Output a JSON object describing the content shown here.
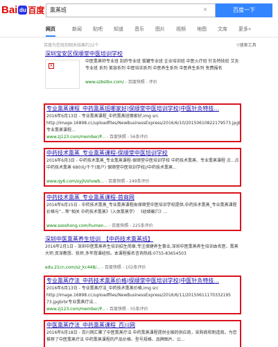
{
  "brand": {
    "bai": "Bai",
    "paw": "du",
    "du": "百度"
  },
  "search": {
    "query": "熏蒸班",
    "clear": "×",
    "button": "百度一下"
  },
  "tabs": [
    "网页",
    "新闻",
    "贴吧",
    "知道",
    "音乐",
    "图片",
    "视频",
    "地图",
    "文库",
    "更多»"
  ],
  "result_count": "百度为您找到相关结果约32个",
  "tools_label": "▽搜索工具",
  "results": [
    {
      "title": "深圳宝安区保顺堂中医培训学校",
      "abstract": "中医熏蒸师专业班 刮痧专业班 拔罐专业班 企业培训班 中医火疗班 针灸特技班 艾灸专业班 系列 美容系列 中医培训系列 中医养生系列 中医养生系列 免费报名",
      "url": "www.szbstbx.com/",
      "links": " - 百度快照 - 评价"
    },
    {
      "title": "专业熏蒸课程_中药熏蒸班哪家好|保顺堂中医培训学校|中医针灸特技...",
      "abstract": "2016年6月13日 - 专业熏蒸课程_中药熏蒸班哪家好,img src http://image.16898.cc/uploadfiles/NewBusinessExpress/2016/6/10/20150610822179573.jpgbrbr专业熏蒸课程...",
      "url": "www.zj123.com/member/P...",
      "links": " - 百度快照 - 56条评价"
    },
    {
      "title": "中药技术熏蒸_专业熏蒸课程-保顺堂中医培训学校",
      "abstract": "2016年6月3日 - 中药技术熏蒸_专业熏蒸课程-保顺堂中医培训学校 中药技术熏蒸、专业熏蒸课程 点...点 中药技术熏蒸 680元/千个(现户) 保顺堂中医培训学校//中药技术熏蒸...",
      "url": "www.qy6.com/syjh/showb...",
      "links": " - 百度快照 - 249条评价"
    },
    {
      "title": "中药技术熏蒸_专业熏蒸课程-首商网",
      "abstract": "2016年6月15日 - 中药技术熏蒸_专业熏蒸课程由保顺堂中医培训学校提供,中药技术熏蒸_专业熏蒸课程价格与“...等”相关 中药技术熏蒸》（入体熏蒸学） 《经络輸穴》...",
      "url": "www.sooshong.com/humen...",
      "links": " - 百度快照 - 225条评价"
    },
    {
      "title": "深圳中医熏蒸养生培训_【中药技术熏蒸班】",
      "abstract": "2016年2月1日 - 深圳中医熏蒸养生培训招生简章,专注保健养生事业,深圳中医熏蒸养生培训由名医、熏蒸大师,资深教授、技师,多年授课经验。本课程报名咨询热线:0755-83654503",
      "url": "edu.21cn.com/sz_kc448/...",
      "links": " - 百度快照 - 102条评价"
    },
    {
      "title": "专业熏蒸疗法_中药技术熏蒸价格|保顺堂中医培训学校|中医针灸特技...",
      "abstract": "2016年6月13日 - 专业熏蒸疗法_中药技术熏蒸价格,img src http://image.16898.cc/uploadfiles/NewBusinessExpress/2016/6/11/20150611170332195 73.jpgbrbr专业熏蒸疗法...",
      "url": "www.zj123.com/member/P...",
      "links": " - 百度快照 - 55条评价"
    },
    {
      "title": "中医熏蒸疗法_中药熏蒸课程_百川网",
      "abstract": "2016年6月18日 - 百川网汇聚了中医熏蒸疗法 中药熏蒸课程提供全国的供应商，采购商和制造商。为您推荐了中医熏蒸疗法 中药熏蒸课程的产品价格、型号规格、品牌图片、公...",
      "url": "",
      "links": ""
    }
  ]
}
